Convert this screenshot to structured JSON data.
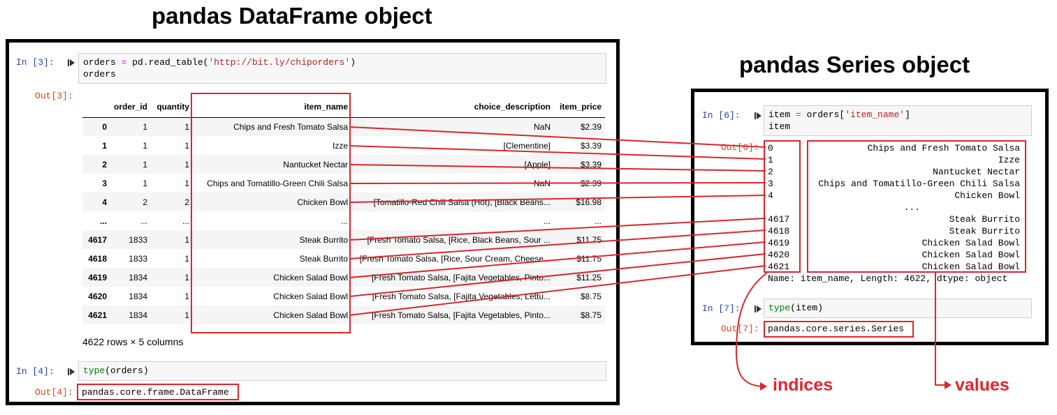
{
  "titles": {
    "dataframe": "pandas DataFrame object",
    "series": "pandas Series object"
  },
  "left_panel": {
    "cell3_in_prompt": "In [3]:",
    "cell3_code_line1_a": "orders ",
    "cell3_code_line1_eq": "=",
    "cell3_code_line1_b": " pd.read_table(",
    "cell3_code_line1_str": "'http://bit.ly/chiporders'",
    "cell3_code_line1_c": ")",
    "cell3_code_line2": "orders",
    "cell3_out_prompt": "Out[3]:",
    "columns": [
      "",
      "order_id",
      "quantity",
      "item_name",
      "choice_description",
      "item_price"
    ],
    "rows": [
      [
        "0",
        "1",
        "1",
        "Chips and Fresh Tomato Salsa",
        "NaN",
        "$2.39"
      ],
      [
        "1",
        "1",
        "1",
        "Izze",
        "[Clementine]",
        "$3.39"
      ],
      [
        "2",
        "1",
        "1",
        "Nantucket Nectar",
        "[Apple]",
        "$3.39"
      ],
      [
        "3",
        "1",
        "1",
        "Chips and Tomatillo-Green Chili Salsa",
        "NaN",
        "$2.39"
      ],
      [
        "4",
        "2",
        "2",
        "Chicken Bowl",
        "[Tomatillo-Red Chili Salsa (Hot), [Black Beans...",
        "$16.98"
      ],
      [
        "...",
        "...",
        "...",
        "...",
        "...",
        "..."
      ],
      [
        "4617",
        "1833",
        "1",
        "Steak Burrito",
        "[Fresh Tomato Salsa, [Rice, Black Beans, Sour ...",
        "$11.75"
      ],
      [
        "4618",
        "1833",
        "1",
        "Steak Burrito",
        "[Fresh Tomato Salsa, [Rice, Sour Cream, Cheese...",
        "$11.75"
      ],
      [
        "4619",
        "1834",
        "1",
        "Chicken Salad Bowl",
        "[Fresh Tomato Salsa, [Fajita Vegetables, Pinto...",
        "$11.25"
      ],
      [
        "4620",
        "1834",
        "1",
        "Chicken Salad Bowl",
        "[Fresh Tomato Salsa, [Fajita Vegetables, Lettu...",
        "$8.75"
      ],
      [
        "4621",
        "1834",
        "1",
        "Chicken Salad Bowl",
        "[Fresh Tomato Salsa, [Fajita Vegetables, Pinto...",
        "$8.75"
      ]
    ],
    "row_count": "4622 rows × 5 columns",
    "cell4_in_prompt": "In [4]:",
    "cell4_code_fn": "type",
    "cell4_code_arg": "(orders)",
    "cell4_out_prompt": "Out[4]:",
    "cell4_output": "pandas.core.frame.DataFrame"
  },
  "right_panel": {
    "cell6_in_prompt": "In [6]:",
    "cell6_code_line1_a": "item ",
    "cell6_code_line1_eq": "=",
    "cell6_code_line1_b": " orders[",
    "cell6_code_line1_str": "'item_name'",
    "cell6_code_line1_c": "]",
    "cell6_code_line2": "item",
    "cell6_out_prompt": "Out[6]:",
    "indices": [
      "0",
      "1",
      "2",
      "3",
      "4",
      "",
      "4617",
      "4618",
      "4619",
      "4620",
      "4621"
    ],
    "values": [
      "Chips and Fresh Tomato Salsa",
      "Izze",
      "Nantucket Nectar",
      "Chips and Tomatillo-Green Chili Salsa",
      "Chicken Bowl",
      "...",
      "Steak Burrito",
      "Steak Burrito",
      "Chicken Salad Bowl",
      "Chicken Salad Bowl",
      "Chicken Salad Bowl"
    ],
    "series_footer": "Name: item_name, Length: 4622, dtype: object",
    "cell7_in_prompt": "In [7]:",
    "cell7_code_fn": "type",
    "cell7_code_arg": "(item)",
    "cell7_out_prompt": "Out[7]:",
    "cell7_output": "pandas.core.series.Series"
  },
  "annotations": {
    "indices": "indices",
    "values": "values"
  },
  "colors": {
    "highlight": "#d9262c",
    "in_prompt": "#303f9f",
    "out_prompt": "#d84315"
  }
}
